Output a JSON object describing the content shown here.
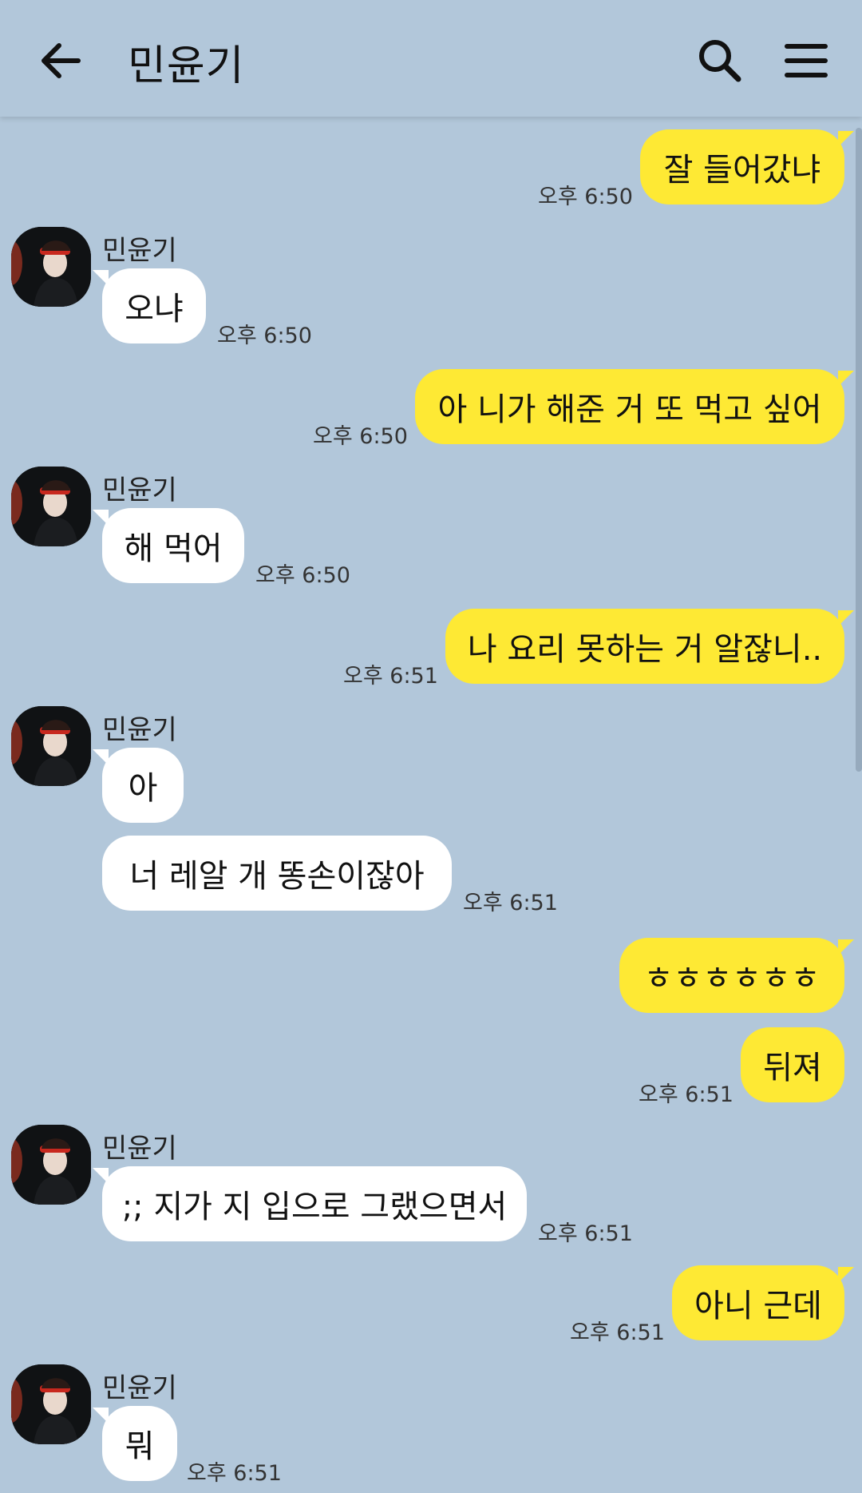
{
  "header": {
    "title": "민윤기",
    "back_icon": "arrow-left-icon",
    "search_icon": "search-icon",
    "menu_icon": "hamburger-menu-icon"
  },
  "colors": {
    "background": "#b2c7da",
    "my_bubble": "#fee934",
    "other_bubble": "#ffffff"
  },
  "messages": [
    {
      "from": "me",
      "text": "잘 들어갔냐",
      "time": "오후 6:50"
    },
    {
      "from": "other",
      "sender": "민윤기",
      "text": "오냐",
      "time": "오후 6:50"
    },
    {
      "from": "me",
      "text": "아 니가 해준 거 또 먹고 싶어",
      "time": "오후 6:50"
    },
    {
      "from": "other",
      "sender": "민윤기",
      "text": "해 먹어",
      "time": "오후 6:50"
    },
    {
      "from": "me",
      "text": "나 요리 못하는 거 알잖니..",
      "time": "오후 6:51"
    },
    {
      "from": "other",
      "sender": "민윤기",
      "text": "아",
      "time": ""
    },
    {
      "from": "other",
      "text": "너 레알 개 똥손이잖아",
      "time": "오후 6:51"
    },
    {
      "from": "me",
      "text": "ㅎㅎㅎㅎㅎㅎ",
      "time": ""
    },
    {
      "from": "me",
      "text": "뒤져",
      "time": "오후 6:51"
    },
    {
      "from": "other",
      "sender": "민윤기",
      "text": ";; 지가 지 입으로 그랬으면서",
      "time": "오후 6:51"
    },
    {
      "from": "me",
      "text": "아니 근데",
      "time": "오후 6:51"
    },
    {
      "from": "other",
      "sender": "민윤기",
      "text": "뭐",
      "time": "오후 6:51"
    }
  ]
}
